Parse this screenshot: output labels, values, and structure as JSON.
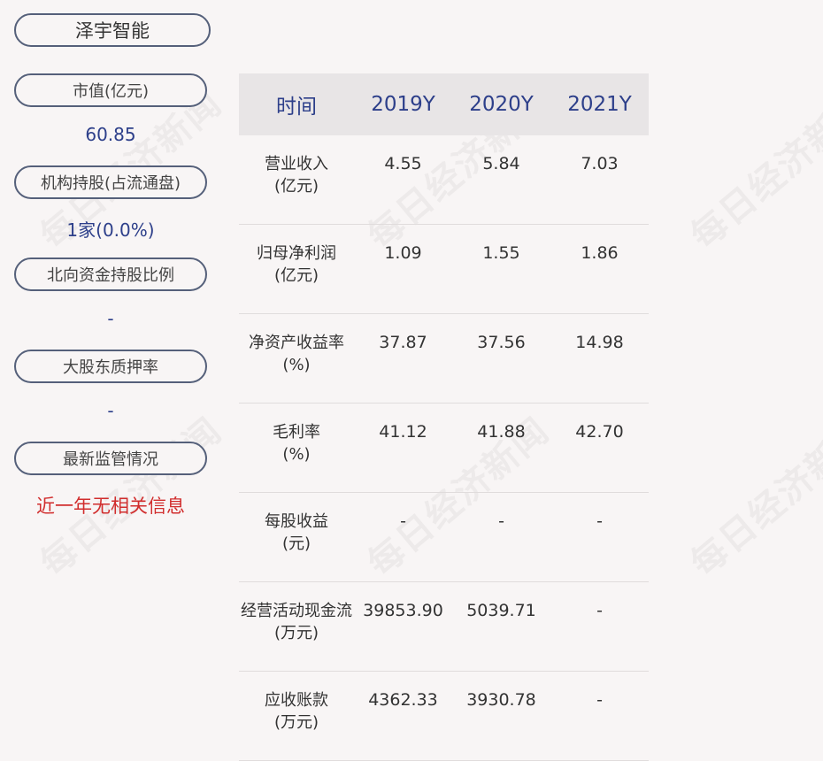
{
  "company": "泽宇智能",
  "left": {
    "market_cap_label": "市值(亿元)",
    "market_cap_value": "60.85",
    "institution_label": "机构持股(占流通盘)",
    "institution_value": "1家(0.0%)",
    "northbound_label": "北向资金持股比例",
    "northbound_value": "-",
    "pledge_label": "大股东质押率",
    "pledge_value": "-",
    "supervision_label": "最新监管情况",
    "supervision_value": "近一年无相关信息"
  },
  "watermark": "每日经济新闻",
  "table": {
    "headers": [
      "时间",
      "2019Y",
      "2020Y",
      "2021Y"
    ],
    "rows": [
      {
        "label1": "营业收入",
        "label2": "(亿元)",
        "values": [
          "4.55",
          "5.84",
          "7.03"
        ]
      },
      {
        "label1": "归母净利润",
        "label2": "(亿元)",
        "values": [
          "1.09",
          "1.55",
          "1.86"
        ]
      },
      {
        "label1": "净资产收益率",
        "label2": "(%)",
        "values": [
          "37.87",
          "37.56",
          "14.98"
        ]
      },
      {
        "label1": "毛利率",
        "label2": "(%)",
        "values": [
          "41.12",
          "41.88",
          "42.70"
        ]
      },
      {
        "label1": "每股收益",
        "label2": "(元)",
        "values": [
          "-",
          "-",
          "-"
        ]
      },
      {
        "label1": "经营活动现金流",
        "label2": "(万元)",
        "values": [
          "39853.90",
          "5039.71",
          "-"
        ]
      },
      {
        "label1": "应收账款",
        "label2": "(万元)",
        "values": [
          "4362.33",
          "3930.78",
          "-"
        ]
      }
    ]
  }
}
